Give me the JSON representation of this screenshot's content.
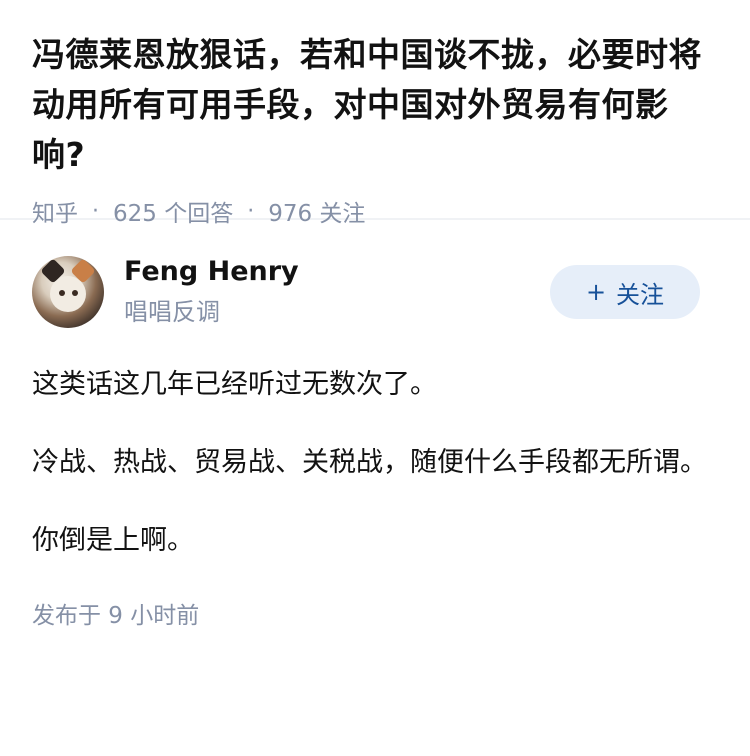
{
  "question": {
    "title": "冯德莱恩放狠话，若和中国谈不拢，必要时将动用所有可用手段，对中国对外贸易有何影响?",
    "source": "知乎",
    "answers_count": "625 个回答",
    "followers_count": "976 关注"
  },
  "answer": {
    "author_name": "Feng Henry",
    "author_bio": "唱唱反调",
    "follow_label": "关注",
    "follow_icon": "plus-icon",
    "paragraphs": [
      "这类话这几年已经听过无数次了。",
      "冷战、热战、贸易战、关税战，随便什么手段都无所谓。",
      "你倒是上啊。"
    ],
    "posted_time": "发布于 9 小时前"
  }
}
